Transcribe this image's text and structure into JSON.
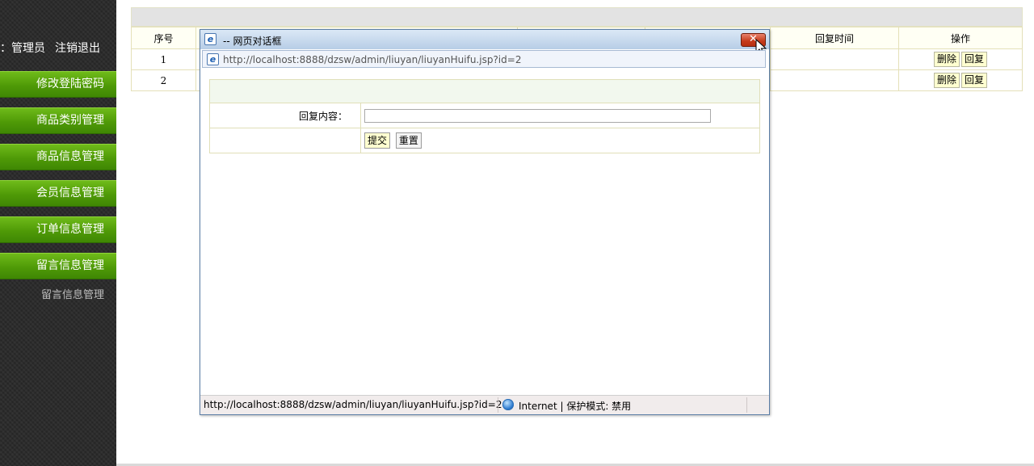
{
  "sidebar": {
    "user_prefix": "：管理员",
    "logout": "注销退出",
    "menu": [
      "修改登陆密码",
      "商品类别管理",
      "商品信息管理",
      "会员信息管理",
      "订单信息管理",
      "留言信息管理"
    ],
    "submenu_item": "留言信息管理"
  },
  "table": {
    "headers": [
      "序号",
      "",
      "",
      "",
      "回复时间",
      "操作"
    ],
    "rows": [
      {
        "index": "1",
        "delete": "删除",
        "reply": "回复"
      },
      {
        "index": "2",
        "delete": "删除",
        "reply": "回复"
      }
    ]
  },
  "dialog": {
    "title": "-- 网页对话框",
    "close_icon": "close-x-icon",
    "address_url": "http://localhost:8888/dzsw/admin/liuyan/liuyanHuifu.jsp?id=2",
    "form": {
      "reply_label": "回复内容：",
      "reply_value": "",
      "submit_label": "提交",
      "reset_label": "重置"
    },
    "status": {
      "url": "http://localhost:8888/dzsw/admin/liuyan/liuyanHuifu.jsp?id=2",
      "zone": "Internet | 保护模式: 禁用"
    }
  },
  "colors": {
    "menu_green": "#4f9a07",
    "sidebar_bg": "#2a2a2a",
    "table_border": "#e4e0b8",
    "button_bg": "#ffffd0"
  }
}
